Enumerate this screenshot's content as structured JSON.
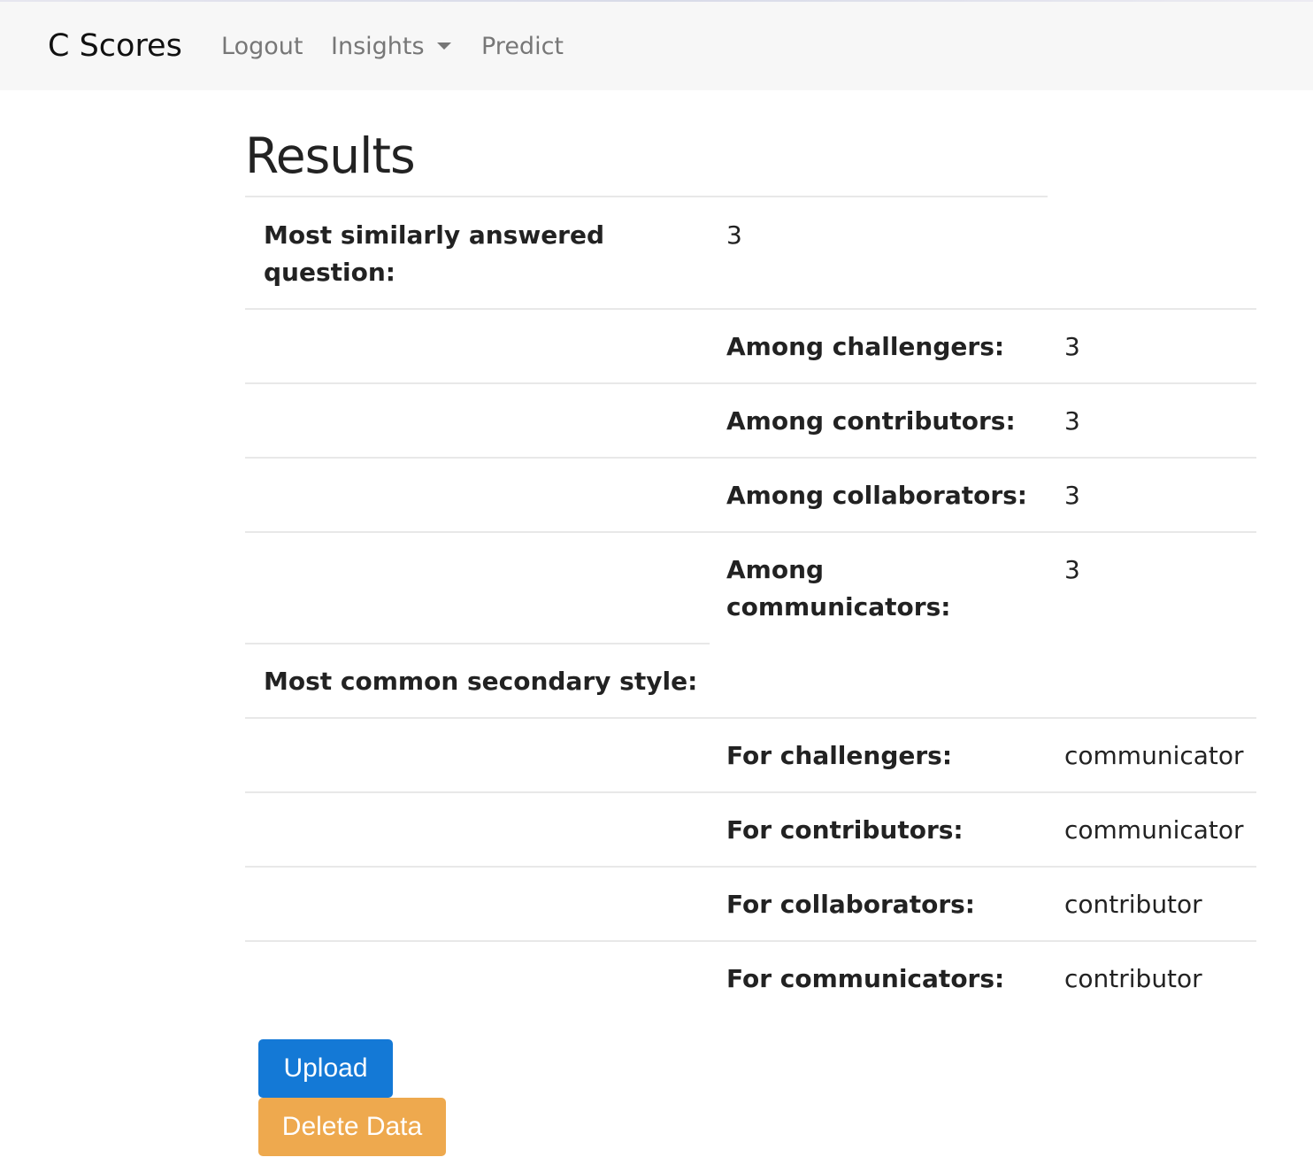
{
  "nav": {
    "brand": "C Scores",
    "links": [
      {
        "label": "Logout"
      },
      {
        "label": "Insights"
      },
      {
        "label": "Predict"
      }
    ]
  },
  "results": {
    "title": "Results",
    "most_similar": {
      "label_line1": "Most similarly answered",
      "label_line2": "question:",
      "value": "3",
      "rows": [
        {
          "label": "Among challengers:",
          "value": "3"
        },
        {
          "label": "Among contributors:",
          "value": "3"
        },
        {
          "label": "Among collaborators:",
          "value": "3"
        },
        {
          "label_line1": "Among",
          "label_line2": "communicators:",
          "value": "3"
        }
      ]
    },
    "secondary": {
      "label": "Most common secondary style:",
      "rows": [
        {
          "label": "For challengers:",
          "value": "communicator"
        },
        {
          "label": "For contributors:",
          "value": "communicator"
        },
        {
          "label": "For collaborators:",
          "value": "contributor"
        },
        {
          "label": "For communicators:",
          "value": "contributor"
        }
      ]
    }
  },
  "actions": {
    "upload_label": "Upload",
    "delete_label": "Delete Data"
  },
  "colors": {
    "upload": "#1479d6",
    "delete": "#eea94e",
    "navbar_bg": "#f7f7f7"
  }
}
